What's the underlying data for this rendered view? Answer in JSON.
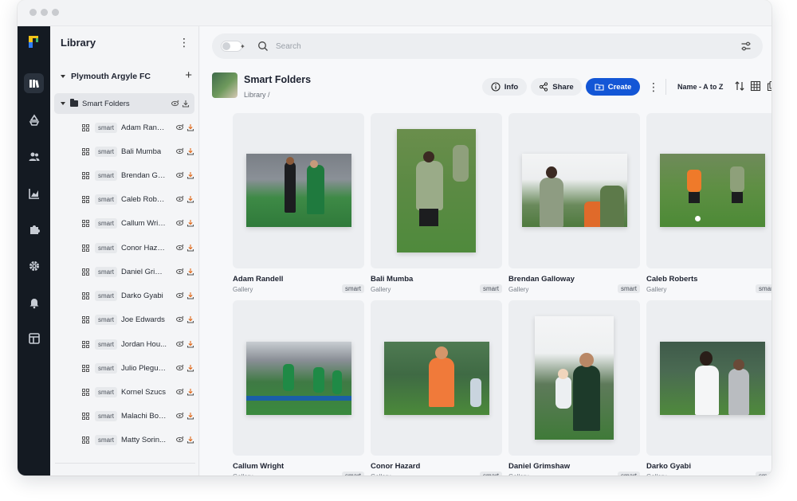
{
  "sidebar": {
    "title": "Library",
    "group_label": "Plymouth Argyle FC",
    "folder_label": "Smart Folders",
    "tag": "smart",
    "items": [
      {
        "label": "Adam Randell"
      },
      {
        "label": "Bali Mumba"
      },
      {
        "label": "Brendan Ga..."
      },
      {
        "label": "Caleb Rober..."
      },
      {
        "label": "Callum Wrig..."
      },
      {
        "label": "Conor Haza..."
      },
      {
        "label": "Daniel Grim..."
      },
      {
        "label": "Darko Gyabi"
      },
      {
        "label": "Joe Edwards"
      },
      {
        "label": "Jordan Hou..."
      },
      {
        "label": "Julio Plegue..."
      },
      {
        "label": "Kornel Szucs"
      },
      {
        "label": "Malachi Boa..."
      },
      {
        "label": "Matty Sorin..."
      }
    ]
  },
  "search": {
    "placeholder": "Search"
  },
  "header": {
    "title": "Smart Folders",
    "breadcrumb": "Library /",
    "info_label": "Info",
    "share_label": "Share",
    "create_label": "Create",
    "sort_label": "Name - A to Z"
  },
  "cards": [
    {
      "name": "Adam Randell",
      "type": "Gallery",
      "tag": "smart"
    },
    {
      "name": "Bali Mumba",
      "type": "Gallery",
      "tag": "smart"
    },
    {
      "name": "Brendan Galloway",
      "type": "Gallery",
      "tag": "smart"
    },
    {
      "name": "Caleb Roberts",
      "type": "Gallery",
      "tag": "smart"
    },
    {
      "name": "Callum Wright",
      "type": "Gallery",
      "tag": "smart"
    },
    {
      "name": "Conor Hazard",
      "type": "Gallery",
      "tag": "smart"
    },
    {
      "name": "Daniel Grimshaw",
      "type": "Gallery",
      "tag": "smart"
    },
    {
      "name": "Darko Gyabi",
      "type": "Gallery",
      "tag": "smart"
    }
  ],
  "colors": {
    "accent": "#1356d6",
    "rail": "#141a22",
    "logo_yellow": "#f2c318",
    "logo_blue": "#2f7cf6"
  }
}
